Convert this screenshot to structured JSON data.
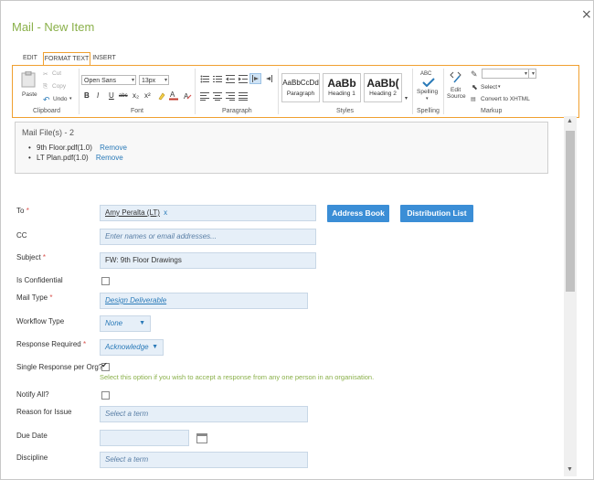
{
  "window": {
    "title": "Mail - New Item",
    "close_glyph": "×"
  },
  "tabs": [
    {
      "label": "EDIT"
    },
    {
      "label": "FORMAT TEXT"
    },
    {
      "label": "INSERT"
    }
  ],
  "active_tab": "FORMAT TEXT",
  "ribbon": {
    "clipboard": {
      "paste": "Paste",
      "cut": "Cut",
      "copy": "Copy",
      "undo": "Undo",
      "label": "Clipboard"
    },
    "font": {
      "family": "Open Sans",
      "size": "13px",
      "label": "Font",
      "bold": "B",
      "italic": "I",
      "underline": "U",
      "strike": "abc",
      "subscript": "x₂",
      "superscript": "x²"
    },
    "paragraph": {
      "label": "Paragraph"
    },
    "styles": {
      "label": "Styles",
      "items": [
        {
          "preview": "AaBbCcDd",
          "name": "Paragraph"
        },
        {
          "preview": "AaBb",
          "name": "Heading 1"
        },
        {
          "preview": "AaBb(",
          "name": "Heading 2"
        }
      ]
    },
    "spelling": {
      "abc": "ABC",
      "button": "Spelling",
      "label": "Spelling"
    },
    "markup": {
      "edit_source_line1": "Edit",
      "edit_source_line2": "Source",
      "select": "Select",
      "convert": "Convert to XHTML",
      "label": "Markup"
    }
  },
  "attachments": {
    "heading": "Mail File(s) - 2",
    "files": [
      {
        "name": "9th Floor.pdf(1.0)",
        "action": "Remove"
      },
      {
        "name": "LT Plan.pdf(1.0)",
        "action": "Remove"
      }
    ]
  },
  "form": {
    "to": {
      "label": "To",
      "required_mark": "*",
      "value": "Amy Peralta (LT)",
      "remove": "x"
    },
    "address_book": "Address Book",
    "distribution_list": "Distribution List",
    "cc": {
      "label": "CC",
      "placeholder": "Enter names or email addresses..."
    },
    "subject": {
      "label": "Subject",
      "required_mark": "*",
      "value": "FW: 9th Floor Drawings"
    },
    "confidential": {
      "label": "Is Confidential",
      "checked": false
    },
    "mail_type": {
      "label": "Mail Type",
      "required_mark": "*",
      "value": "Design Deliverable"
    },
    "workflow_type": {
      "label": "Workflow Type",
      "value": "None"
    },
    "response_required": {
      "label": "Response Required",
      "required_mark": "*",
      "value": "Acknowledge"
    },
    "single_response": {
      "label": "Single Response per Org?",
      "checked": true,
      "hint": "Select this option if you wish to accept a response from any one person in an organisation."
    },
    "notify_all": {
      "label": "Notify All?",
      "checked": false
    },
    "reason": {
      "label": "Reason for Issue",
      "placeholder": "Select a term"
    },
    "due_date": {
      "label": "Due Date",
      "value": ""
    },
    "discipline": {
      "label": "Discipline",
      "placeholder": "Select a term"
    }
  },
  "colors": {
    "accent_orange": "#f0a030",
    "title_green": "#8ab04a",
    "button_blue": "#3b8ed6",
    "field_bg": "#e6eff8",
    "required_red": "#d9534f"
  },
  "icons": [
    "close-icon",
    "paste-icon",
    "cut-icon",
    "copy-icon",
    "undo-icon",
    "spelling-check-icon",
    "edit-source-icon",
    "select-cursor-icon",
    "convert-icon",
    "calendar-icon",
    "chevron-down-icon"
  ]
}
